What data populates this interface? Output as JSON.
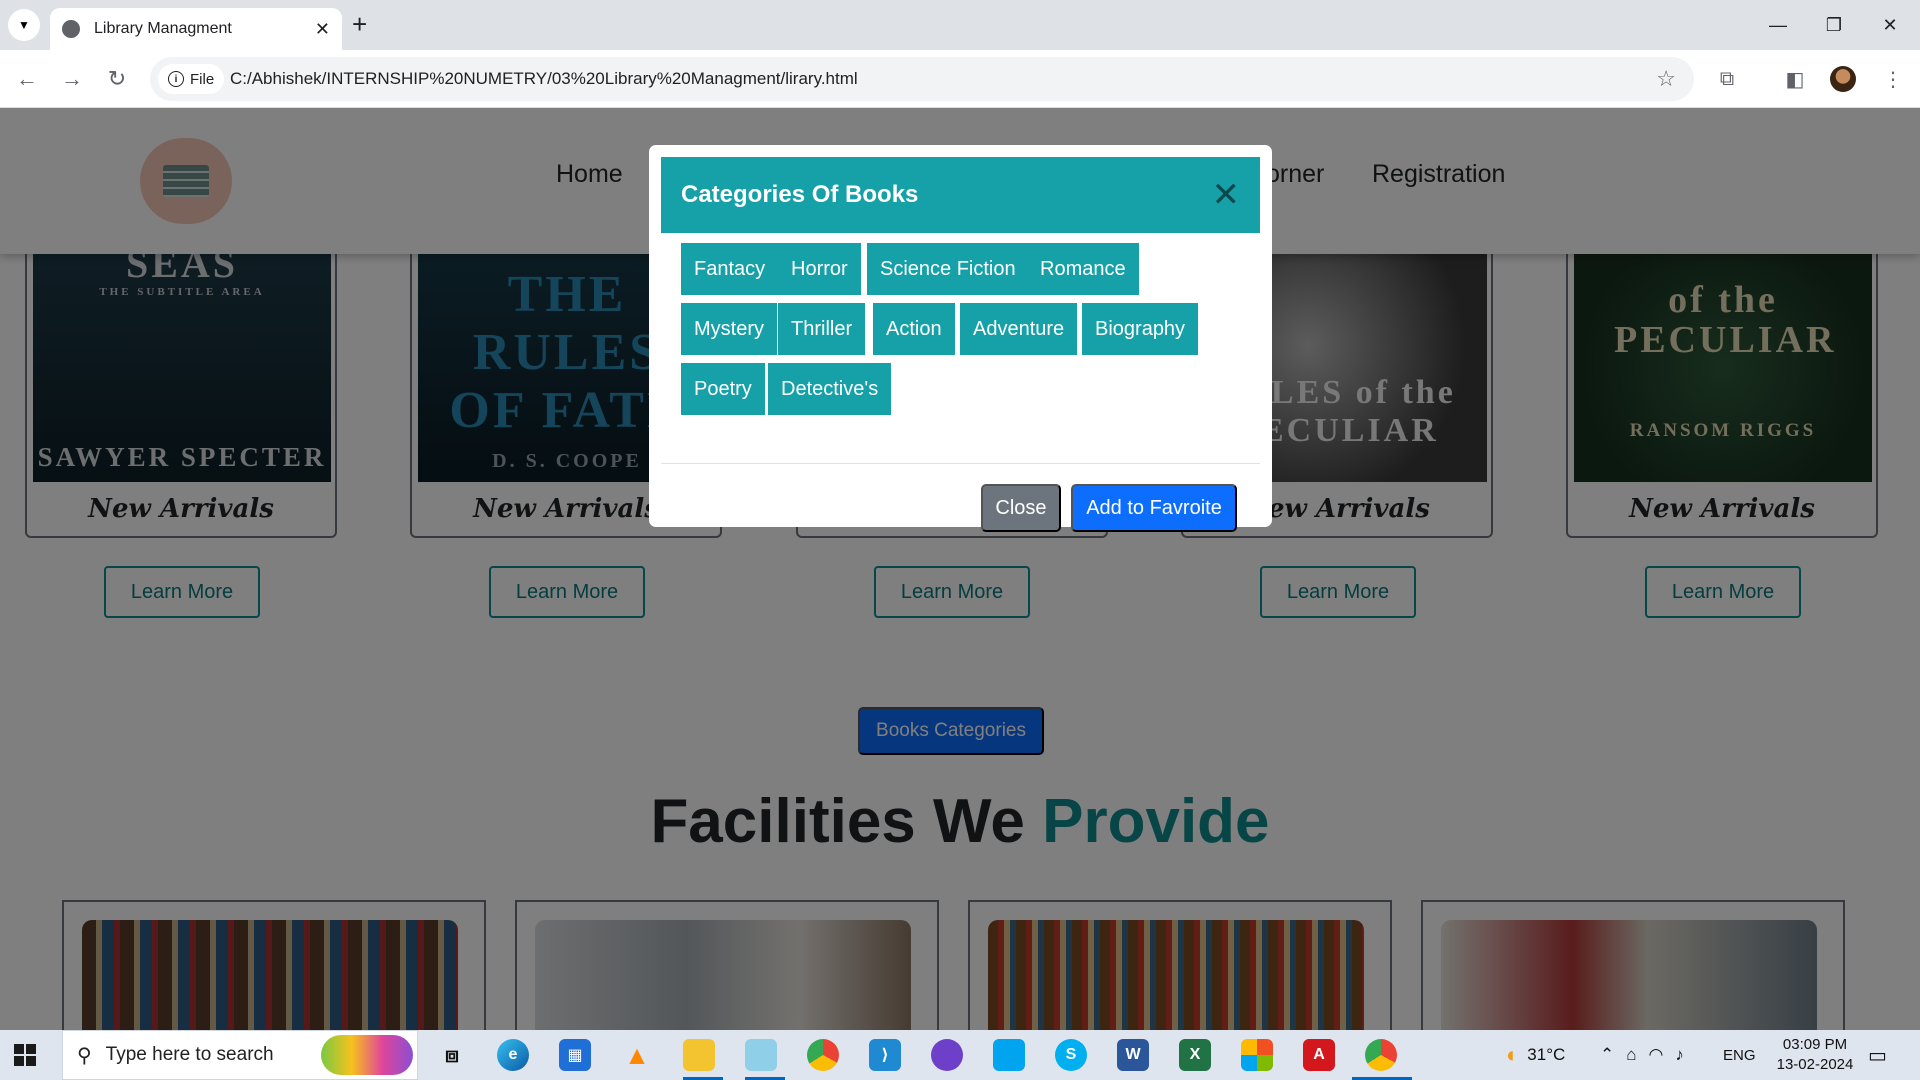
{
  "browser": {
    "tab_title": "Library Managment",
    "chip_label": "File",
    "url": "C:/Abhishek/INTERNSHIP%20NUMETRY/03%20Library%20Managment/lirary.html"
  },
  "site": {
    "nav": {
      "home": "Home",
      "corner": "orner",
      "registration": "Registration"
    },
    "books": [
      {
        "cover_title": "SEAS",
        "cover_subtitle": "THE SUBTITLE AREA",
        "cover_author": "SAWYER SPECTER",
        "label": "New Arrivals",
        "button": "Learn More"
      },
      {
        "cover_title": "THE RULES OF FATE",
        "cover_subtitle": "",
        "cover_author": "D. S. COOPE",
        "label": "New Arrivals",
        "button": "Learn More"
      },
      {
        "cover_title": "",
        "cover_subtitle": "",
        "cover_author": "",
        "label": "",
        "button": "Learn More"
      },
      {
        "cover_title": "TALES of the PECULIAR",
        "cover_subtitle": "",
        "cover_author": "",
        "label": "New Arrivals",
        "button": "Learn More"
      },
      {
        "cover_title": "of the PECULIAR",
        "cover_subtitle": "",
        "cover_author": "RANSOM RIGGS",
        "label": "New Arrivals",
        "button": "Learn More"
      }
    ],
    "categories_button": "Books Categories",
    "facilities_title": "Facilities We",
    "facilities_accent": "Provide"
  },
  "modal": {
    "title": "Categories Of Books",
    "genres": [
      "Fantacy",
      "Horror",
      "Science Fiction",
      "Romance",
      "Mystery",
      "Thriller",
      "Action",
      "Adventure",
      "Biography",
      "Poetry",
      "Detective's"
    ],
    "close_label": "Close",
    "favorite_label": "Add to Favroite"
  },
  "taskbar": {
    "search_placeholder": "Type here to search",
    "temperature": "31°C",
    "language": "ENG",
    "time": "03:09 PM",
    "date": "13-02-2024"
  },
  "colors": {
    "teal": "#16a1a8",
    "primary": "#0d6efd",
    "secondary": "#6c757d"
  }
}
